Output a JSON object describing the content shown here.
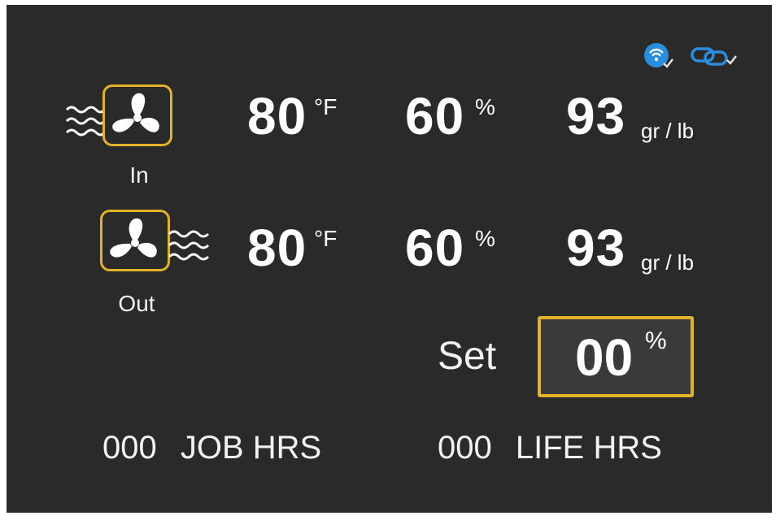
{
  "status": {
    "wifi_icon": "wifi-connected-icon",
    "link_icon": "link-connected-icon",
    "wifi_color": "#2a8ee0",
    "link_color": "#2a8ee0"
  },
  "inlet": {
    "label": "In",
    "temp_value": "80",
    "temp_unit": "°F",
    "humidity_value": "60",
    "humidity_unit": "%",
    "grains_value": "93",
    "grains_unit": "gr / lb"
  },
  "outlet": {
    "label": "Out",
    "temp_value": "80",
    "temp_unit": "°F",
    "humidity_value": "60",
    "humidity_unit": "%",
    "grains_value": "93",
    "grains_unit": "gr / lb"
  },
  "setpoint": {
    "label": "Set",
    "value": "00",
    "unit": "%"
  },
  "hours": {
    "job_value": "000",
    "job_label": "JOB HRS",
    "life_value": "000",
    "life_label": "LIFE HRS"
  },
  "colors": {
    "background": "#2a2a2b",
    "accent": "#e3b22b",
    "text": "#ffffff"
  }
}
